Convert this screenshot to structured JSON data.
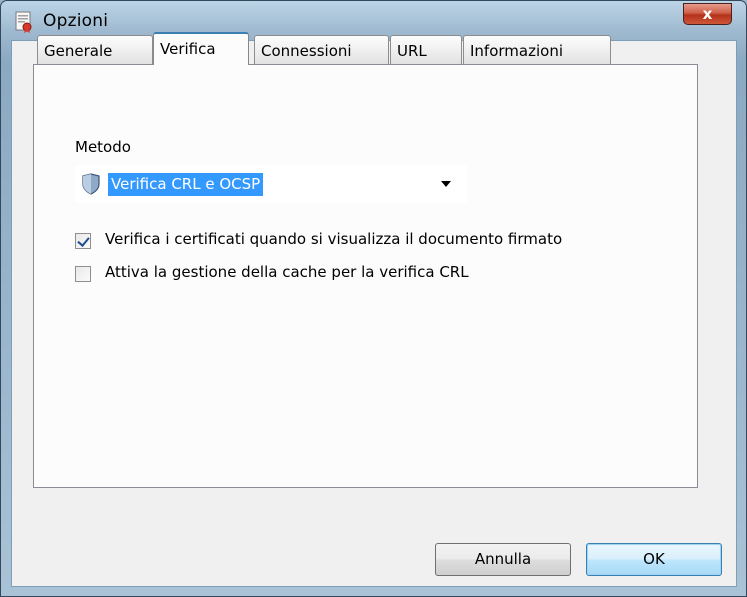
{
  "window": {
    "title": "Opzioni",
    "close_label": "x"
  },
  "tabs": [
    {
      "label": "Generale",
      "active": false
    },
    {
      "label": "Verifica",
      "active": true
    },
    {
      "label": "Connessioni",
      "active": false
    },
    {
      "label": "URL",
      "active": false
    },
    {
      "label": "Informazioni",
      "active": false
    }
  ],
  "verifica": {
    "method_label": "Metodo",
    "method_value": "Verifica CRL e OCSP",
    "options": [
      {
        "label": "Verifica i certificati quando si visualizza il documento firmato",
        "checked": true
      },
      {
        "label": "Attiva la gestione della cache per la verifica CRL",
        "checked": false
      }
    ]
  },
  "buttons": {
    "cancel_label": "Annulla",
    "ok_label": "OK"
  },
  "icons": {
    "app": "options-app-icon",
    "method": "shield-icon",
    "dropdown": "chevron-down-icon"
  },
  "colors": {
    "selection": "#3399ff",
    "tab_accent": "#3c7fb1",
    "close_button": "#c7452b"
  }
}
